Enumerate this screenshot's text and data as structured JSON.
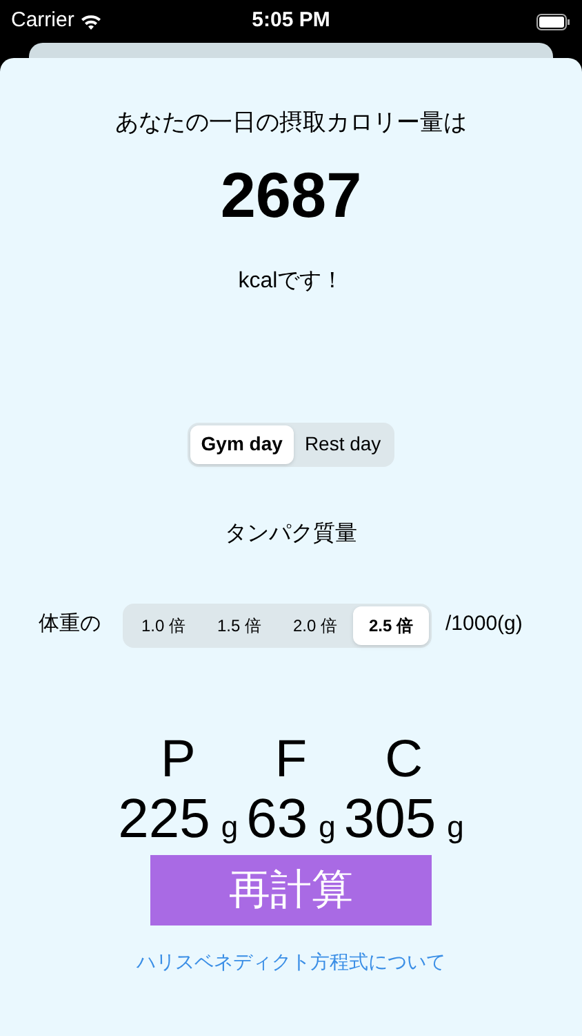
{
  "status_bar": {
    "carrier": "Carrier",
    "time": "5:05 PM"
  },
  "intro": "あなたの一日の摂取カロリー量は",
  "calories": "2687",
  "unit_text": "kcalです！",
  "day_tabs": [
    {
      "label": "Gym day",
      "selected": true
    },
    {
      "label": "Rest day",
      "selected": false
    }
  ],
  "protein_label": "タンパク質量",
  "weight_prefix": "体重の",
  "multipliers": [
    {
      "label": "1.0 倍",
      "selected": false
    },
    {
      "label": "1.5 倍",
      "selected": false
    },
    {
      "label": "2.0 倍",
      "selected": false
    },
    {
      "label": "2.5 倍",
      "selected": true
    }
  ],
  "weight_suffix": "/1000(g)",
  "macros": [
    {
      "letter": "P",
      "amount": "225",
      "unit": "g"
    },
    {
      "letter": "F",
      "amount": "63",
      "unit": "g"
    },
    {
      "letter": "C",
      "amount": "305",
      "unit": "g"
    }
  ],
  "recalc_button": "再計算",
  "link": "ハリスベネディクト方程式について"
}
